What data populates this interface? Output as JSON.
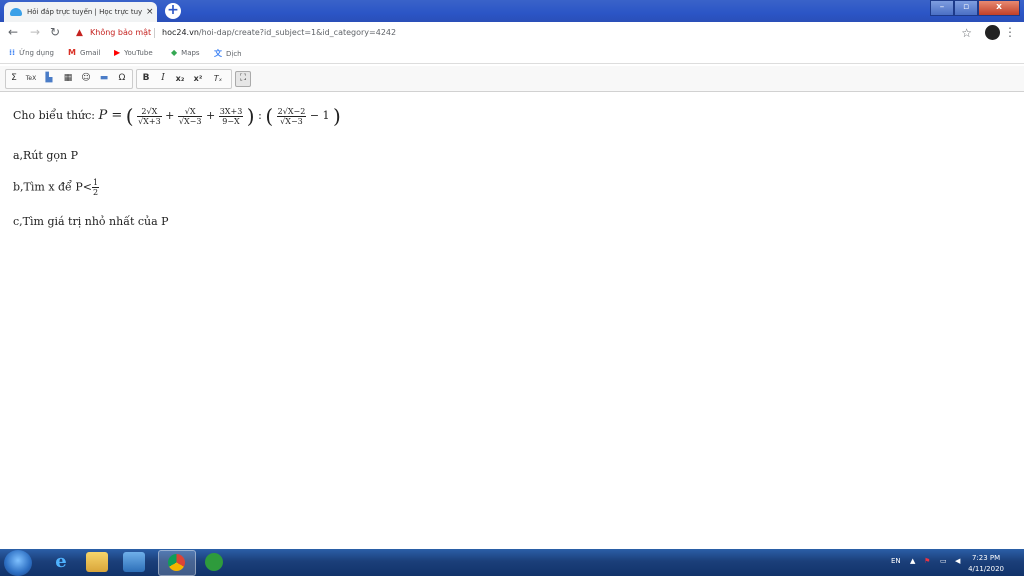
{
  "browser": {
    "tab_title": "Hỏi đáp trực tuyến | Học trực tuy",
    "tab_close": "×",
    "new_tab": "+",
    "security_label": "Không bảo mật",
    "url_host": "hoc24.vn",
    "url_path": "/hoi-dap/create?id_subject=1&id_category=4242",
    "star": "☆",
    "menu": "⋮"
  },
  "bookmarks": [
    {
      "label": "Ứng dụng",
      "icon": "apps-icon"
    },
    {
      "label": "Gmail",
      "icon": "gmail-icon"
    },
    {
      "label": "YouTube",
      "icon": "youtube-icon"
    },
    {
      "label": "Maps",
      "icon": "maps-icon"
    },
    {
      "label": "Dịch",
      "icon": "translate-icon"
    }
  ],
  "toolbar": {
    "sum": "Σ",
    "tex": "TeX",
    "bold": "B",
    "italic": "I",
    "subscript": "x₂",
    "superscript": "x²",
    "clear_format": "Tₓ",
    "omega": "Ω"
  },
  "content": {
    "intro": "Cho biểu thức: ",
    "formula": {
      "P": "P =",
      "f1_num": "2√X",
      "f1_den": "√X+3",
      "plus1": "+",
      "f2_num": "√X",
      "f2_den": "√X−3",
      "plus2": "+",
      "f3_num": "3X+3",
      "f3_den": "9−X",
      "colon": ":",
      "f4_num": "2√X−2",
      "f4_den": "√X−3",
      "minus_one": "− 1"
    },
    "q_a": "a,Rút gọn P",
    "q_b_prefix": "b,Tìm x để P<",
    "q_b_num": "1",
    "q_b_den": "2",
    "q_c": "c,Tìm giá trị nhỏ nhất của P"
  },
  "taskbar": {
    "lang": "EN",
    "time": "7:23 PM",
    "date": "4/11/2020"
  }
}
